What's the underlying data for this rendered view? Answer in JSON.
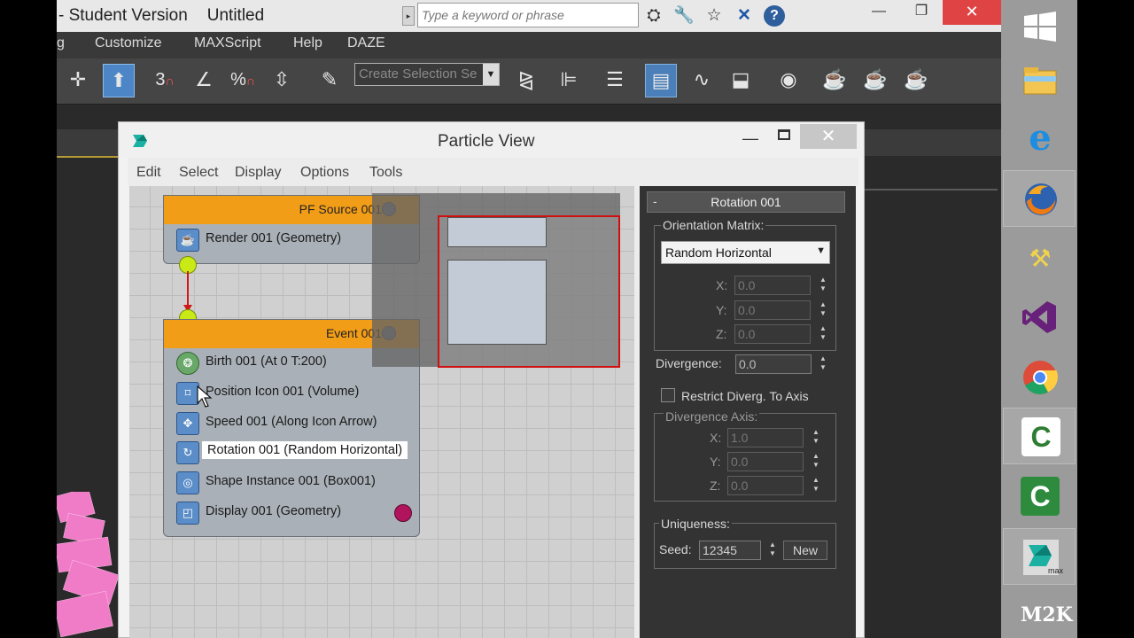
{
  "max_window": {
    "title": "- Student Version",
    "document": "Untitled",
    "search_placeholder": "Type a keyword or phrase",
    "menu": [
      "g",
      "Customize",
      "MAXScript",
      "Help",
      "DAZE"
    ],
    "selection_set_placeholder": "Create Selection Se",
    "toolbar_labels": {
      "snaps": "3",
      "angle": "",
      "percent": "%"
    }
  },
  "particle_view": {
    "title": "Particle View",
    "menu": [
      "Edit",
      "Select",
      "Display",
      "Options",
      "Tools"
    ],
    "source_node": {
      "title": "PF Source 001",
      "operators": [
        {
          "label": "Render 001 (Geometry)",
          "icon": "teapot-icon"
        }
      ]
    },
    "event_node": {
      "title": "Event 001",
      "operators": [
        {
          "label": "Birth 001 (At 0 T:200)",
          "icon": "birth-icon",
          "selected": false
        },
        {
          "label": "Position Icon 001 (Volume)",
          "icon": "position-icon",
          "selected": false
        },
        {
          "label": "Speed 001 (Along Icon Arrow)",
          "icon": "speed-icon",
          "selected": false
        },
        {
          "label": "Rotation 001 (Random Horizontal)",
          "icon": "rotation-icon",
          "selected": true
        },
        {
          "label": "Shape Instance 001 (Box001)",
          "icon": "shape-instance-icon",
          "selected": false
        },
        {
          "label": "Display 001 (Geometry)",
          "icon": "display-icon",
          "selected": false
        }
      ],
      "display_color": "#b0145c"
    },
    "rotation_panel": {
      "header_symbol": "-",
      "header": "Rotation 001",
      "orientation_label": "Orientation Matrix:",
      "orientation_value": "Random Horizontal",
      "x_label": "X:",
      "y_label": "Y:",
      "z_label": "Z:",
      "x_value": "0.0",
      "y_value": "0.0",
      "z_value": "0.0",
      "divergence_label": "Divergence:",
      "divergence_value": "0.0",
      "restrict_label": "Restrict Diverg. To Axis",
      "axis_group_label": "Divergence Axis:",
      "axis_x": "1.0",
      "axis_y": "0.0",
      "axis_z": "0.0",
      "uniqueness_label": "Uniqueness:",
      "seed_label": "Seed:",
      "seed_value": "12345",
      "new_label": "New"
    }
  },
  "taskbar": {
    "items": [
      {
        "name": "windows-start-icon"
      },
      {
        "name": "file-explorer-icon"
      },
      {
        "name": "internet-explorer-icon"
      },
      {
        "name": "firefox-icon"
      },
      {
        "name": "tools-icon"
      },
      {
        "name": "visual-studio-icon"
      },
      {
        "name": "chrome-icon"
      },
      {
        "name": "camtasia-icon"
      },
      {
        "name": "camtasia-recorder-icon"
      },
      {
        "name": "3ds-max-icon"
      },
      {
        "name": "m2k-icon"
      }
    ],
    "m2k_label": "M2K",
    "max_sublabel": "max"
  }
}
